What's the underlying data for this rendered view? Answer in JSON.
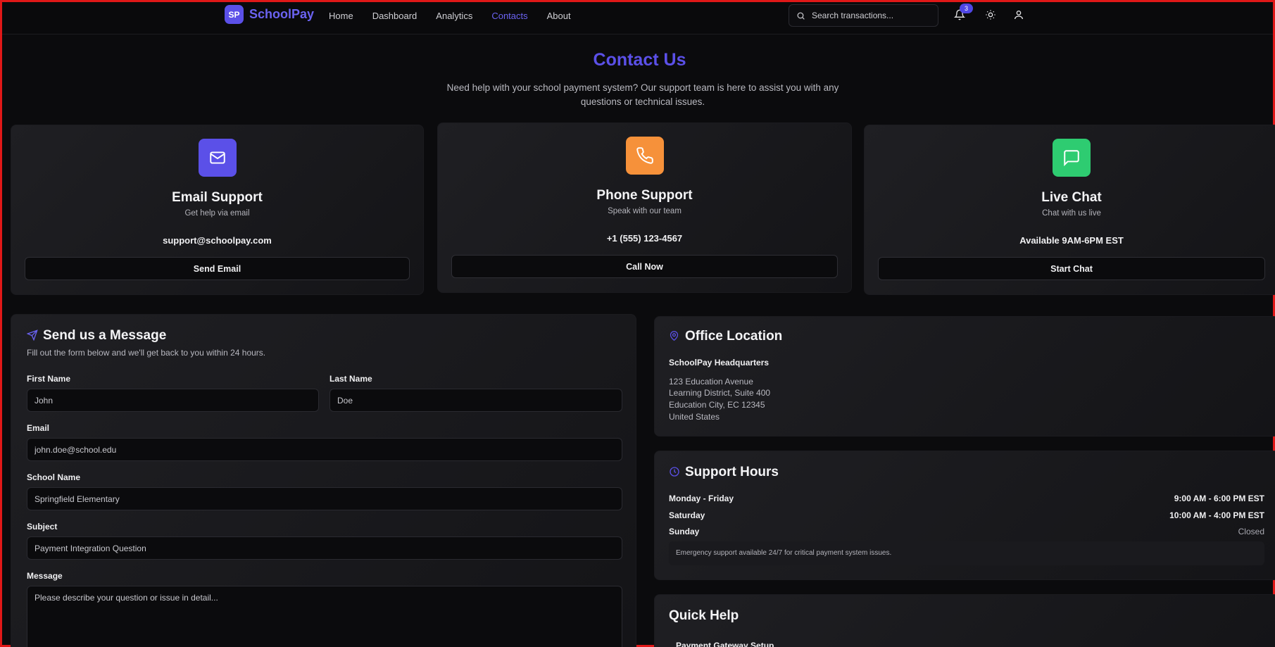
{
  "brand": {
    "logo_text": "SP",
    "name": "SchoolPay",
    "color": "#5b50e8"
  },
  "nav": {
    "items": [
      "Home",
      "Dashboard",
      "Analytics",
      "Contacts",
      "About"
    ],
    "active": "Contacts"
  },
  "search": {
    "placeholder": "Search transactions..."
  },
  "notifications": {
    "count": "3"
  },
  "hero": {
    "title": "Contact Us",
    "subtitle": "Need help with your school payment system? Our support team is here to assist you with any questions or technical issues."
  },
  "support_cards": [
    {
      "icon": "mail-icon",
      "color": "#5b50e8",
      "title": "Email Support",
      "subtitle": "Get help via email",
      "contact": "support@schoolpay.com",
      "button": "Send Email"
    },
    {
      "icon": "phone-icon",
      "color": "#f6913a",
      "title": "Phone Support",
      "subtitle": "Speak with our team",
      "contact": "+1 (555) 123-4567",
      "button": "Call Now"
    },
    {
      "icon": "chat-icon",
      "color": "#2ecc71",
      "title": "Live Chat",
      "subtitle": "Chat with us live",
      "contact": "Available 9AM-6PM EST",
      "button": "Start Chat"
    }
  ],
  "form": {
    "title": "Send us a Message",
    "subtitle": "Fill out the form below and we'll get back to you within 24 hours.",
    "first_name": {
      "label": "First Name",
      "placeholder": "John"
    },
    "last_name": {
      "label": "Last Name",
      "placeholder": "Doe"
    },
    "email": {
      "label": "Email",
      "placeholder": "john.doe@school.edu"
    },
    "school": {
      "label": "School Name",
      "placeholder": "Springfield Elementary"
    },
    "subject": {
      "label": "Subject",
      "placeholder": "Payment Integration Question"
    },
    "message": {
      "label": "Message",
      "placeholder": "Please describe your question or issue in detail..."
    }
  },
  "office": {
    "title": "Office Location",
    "name": "SchoolPay Headquarters",
    "address": [
      "123 Education Avenue",
      "Learning District, Suite 400",
      "Education City, EC 12345",
      "United States"
    ]
  },
  "hours": {
    "title": "Support Hours",
    "rows": [
      {
        "day": "Monday - Friday",
        "time": "9:00 AM - 6:00 PM EST"
      },
      {
        "day": "Saturday",
        "time": "10:00 AM - 4:00 PM EST"
      },
      {
        "day": "Sunday",
        "time": "Closed"
      }
    ],
    "note": "Emergency support available 24/7 for critical payment system issues."
  },
  "quick_help": {
    "title": "Quick Help",
    "first_item": "Payment Gateway Setup"
  }
}
